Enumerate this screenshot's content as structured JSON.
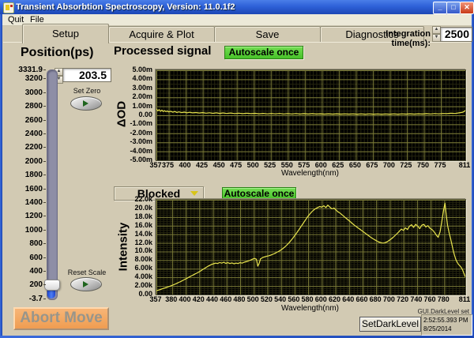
{
  "window": {
    "title": "Transient Absorbtion Spectroscopy, Version: 11.0.1f2"
  },
  "menu": {
    "quit": "Quit",
    "file": "File"
  },
  "tabs": {
    "setup": "Setup",
    "acquire": "Acquire & Plot",
    "save": "Save",
    "diagnostics": "Diagnostics",
    "active": "Setup"
  },
  "integration": {
    "label": "Integration time(ms):",
    "value": "2500"
  },
  "position": {
    "title": "Position(ps)",
    "value": "203.5",
    "min": -3.7,
    "max": 3331.9,
    "handle_value": 203.5,
    "set_zero": "Set Zero",
    "reset_scale": "Reset Scale",
    "abort": "Abort Move",
    "ticks": [
      {
        "v": 3331.9,
        "label": "3331.9"
      },
      {
        "v": 3200,
        "label": "3200"
      },
      {
        "v": 3000,
        "label": "3000"
      },
      {
        "v": 2800,
        "label": "2800"
      },
      {
        "v": 2600,
        "label": "2600"
      },
      {
        "v": 2400,
        "label": "2400"
      },
      {
        "v": 2200,
        "label": "2200"
      },
      {
        "v": 2000,
        "label": "2000"
      },
      {
        "v": 1800,
        "label": "1800"
      },
      {
        "v": 1600,
        "label": "1600"
      },
      {
        "v": 1400,
        "label": "1400"
      },
      {
        "v": 1200,
        "label": "1200"
      },
      {
        "v": 1000,
        "label": "1000"
      },
      {
        "v": 800,
        "label": "800"
      },
      {
        "v": 600,
        "label": "600"
      },
      {
        "v": 400,
        "label": "400"
      },
      {
        "v": 200,
        "label": "200"
      },
      {
        "v": -3.7,
        "label": "-3.7"
      }
    ]
  },
  "dark": {
    "button": "SetDarkLevel",
    "note": "GUI.DarkLevel set",
    "time": "2:52:55.393 PM",
    "date": "8/25/2014"
  },
  "colors": {
    "accent_green": "#55CF35",
    "curve": "#E8E44E",
    "plot_bg": "#000000",
    "grid_major": "#7D7D38",
    "grid_minor": "#25250E",
    "titlebar_blue": "#2E61D8"
  },
  "chart_data": [
    {
      "type": "line",
      "title": "Processed signal",
      "autoscale_label": "Autoscale once",
      "xlabel": "Wavelength(nm)",
      "ylabel": "ΔOD",
      "xlim": [
        357,
        811
      ],
      "ylim": [
        -5,
        5
      ],
      "y_unit": "m (milli-OD)",
      "x_ticks": [
        357,
        375,
        400,
        425,
        450,
        475,
        500,
        525,
        550,
        575,
        600,
        625,
        650,
        675,
        700,
        725,
        750,
        775,
        811
      ],
      "y_ticks": [
        {
          "v": 5,
          "label": "5.00m"
        },
        {
          "v": 4,
          "label": "4.00m"
        },
        {
          "v": 3,
          "label": "3.00m"
        },
        {
          "v": 2,
          "label": "2.00m"
        },
        {
          "v": 1,
          "label": "1.00m"
        },
        {
          "v": 0,
          "label": "0.00"
        },
        {
          "v": -1,
          "label": "-1.00m"
        },
        {
          "v": -2,
          "label": "-2.00m"
        },
        {
          "v": -3,
          "label": "-3.00m"
        },
        {
          "v": -4,
          "label": "-4.00m"
        },
        {
          "v": -5,
          "label": "-5.00m"
        }
      ],
      "points": [
        [
          357,
          0.72
        ],
        [
          359,
          0.5
        ],
        [
          361,
          0.62
        ],
        [
          363,
          0.44
        ],
        [
          365,
          0.58
        ],
        [
          367,
          0.42
        ],
        [
          369,
          0.52
        ],
        [
          371,
          0.4
        ],
        [
          373,
          0.48
        ],
        [
          375,
          0.38
        ],
        [
          378,
          0.45
        ],
        [
          381,
          0.34
        ],
        [
          384,
          0.42
        ],
        [
          387,
          0.32
        ],
        [
          390,
          0.38
        ],
        [
          394,
          0.3
        ],
        [
          398,
          0.35
        ],
        [
          402,
          0.28
        ],
        [
          406,
          0.33
        ],
        [
          410,
          0.27
        ],
        [
          415,
          0.31
        ],
        [
          420,
          0.25
        ],
        [
          425,
          0.3
        ],
        [
          430,
          0.24
        ],
        [
          435,
          0.28
        ],
        [
          440,
          0.22
        ],
        [
          445,
          0.27
        ],
        [
          450,
          0.21
        ],
        [
          455,
          0.26
        ],
        [
          460,
          0.2
        ],
        [
          466,
          0.25
        ],
        [
          472,
          0.19
        ],
        [
          478,
          0.24
        ],
        [
          484,
          0.18
        ],
        [
          490,
          0.23
        ],
        [
          496,
          0.18
        ],
        [
          502,
          0.22
        ],
        [
          508,
          0.17
        ],
        [
          514,
          0.21
        ],
        [
          520,
          0.16
        ],
        [
          526,
          0.2
        ],
        [
          532,
          0.16
        ],
        [
          538,
          0.2
        ],
        [
          544,
          0.15
        ],
        [
          550,
          0.19
        ],
        [
          556,
          0.15
        ],
        [
          562,
          0.19
        ],
        [
          568,
          0.14
        ],
        [
          574,
          0.18
        ],
        [
          580,
          0.14
        ],
        [
          586,
          0.18
        ],
        [
          592,
          0.14
        ],
        [
          598,
          0.17
        ],
        [
          604,
          0.13
        ],
        [
          610,
          0.17
        ],
        [
          616,
          0.13
        ],
        [
          622,
          0.17
        ],
        [
          628,
          0.13
        ],
        [
          634,
          0.16
        ],
        [
          640,
          0.13
        ],
        [
          646,
          0.16
        ],
        [
          652,
          0.12
        ],
        [
          658,
          0.16
        ],
        [
          664,
          0.12
        ],
        [
          670,
          0.16
        ],
        [
          676,
          0.12
        ],
        [
          682,
          0.15
        ],
        [
          688,
          0.12
        ],
        [
          694,
          0.15
        ],
        [
          700,
          0.12
        ],
        [
          706,
          0.16
        ],
        [
          712,
          0.12
        ],
        [
          718,
          0.16
        ],
        [
          724,
          0.13
        ],
        [
          730,
          0.17
        ],
        [
          736,
          0.13
        ],
        [
          742,
          0.17
        ],
        [
          748,
          0.14
        ],
        [
          754,
          0.18
        ],
        [
          760,
          0.15
        ],
        [
          766,
          0.19
        ],
        [
          772,
          0.16
        ],
        [
          778,
          0.2
        ],
        [
          784,
          0.18
        ],
        [
          790,
          0.23
        ],
        [
          796,
          0.2
        ],
        [
          802,
          0.27
        ],
        [
          806,
          0.32
        ],
        [
          809,
          0.4
        ],
        [
          811,
          0.55
        ]
      ]
    },
    {
      "type": "line",
      "title": "Blocked",
      "title_is_dropdown": true,
      "autoscale_label": "Autoscale once",
      "xlabel": "Wavelength(nm)",
      "ylabel": "Intensity",
      "xlim": [
        357,
        811
      ],
      "ylim": [
        0,
        22
      ],
      "y_unit": "k (kilo-counts)",
      "x_ticks": [
        357,
        380,
        400,
        420,
        440,
        460,
        480,
        500,
        520,
        540,
        560,
        580,
        600,
        620,
        640,
        660,
        680,
        700,
        720,
        740,
        760,
        780,
        811
      ],
      "y_ticks": [
        {
          "v": 22,
          "label": "22.0k"
        },
        {
          "v": 20,
          "label": "20.0k"
        },
        {
          "v": 18,
          "label": "18.0k"
        },
        {
          "v": 16,
          "label": "16.0k"
        },
        {
          "v": 14,
          "label": "14.0k"
        },
        {
          "v": 12,
          "label": "12.0k"
        },
        {
          "v": 10,
          "label": "10.0k"
        },
        {
          "v": 8,
          "label": "8.00k"
        },
        {
          "v": 6,
          "label": "6.00k"
        },
        {
          "v": 4,
          "label": "4.00k"
        },
        {
          "v": 2,
          "label": "2.00k"
        },
        {
          "v": 0,
          "label": "0.00"
        }
      ],
      "points": [
        [
          357,
          0.9
        ],
        [
          360,
          1.05
        ],
        [
          363,
          1.2
        ],
        [
          366,
          1.35
        ],
        [
          369,
          1.5
        ],
        [
          372,
          1.65
        ],
        [
          375,
          1.85
        ],
        [
          378,
          2.0
        ],
        [
          381,
          2.2
        ],
        [
          384,
          2.4
        ],
        [
          387,
          2.6
        ],
        [
          390,
          2.85
        ],
        [
          393,
          3.05
        ],
        [
          396,
          3.3
        ],
        [
          399,
          3.55
        ],
        [
          402,
          3.8
        ],
        [
          405,
          4.05
        ],
        [
          408,
          4.3
        ],
        [
          411,
          4.55
        ],
        [
          414,
          4.8
        ],
        [
          417,
          5.05
        ],
        [
          420,
          5.3
        ],
        [
          423,
          5.6
        ],
        [
          426,
          5.9
        ],
        [
          429,
          6.2
        ],
        [
          432,
          6.5
        ],
        [
          435,
          6.75
        ],
        [
          438,
          7.0
        ],
        [
          441,
          7.15
        ],
        [
          444,
          7.3
        ],
        [
          447,
          7.2
        ],
        [
          450,
          7.45
        ],
        [
          453,
          7.3
        ],
        [
          456,
          7.5
        ],
        [
          459,
          7.25
        ],
        [
          462,
          7.4
        ],
        [
          465,
          7.2
        ],
        [
          468,
          7.35
        ],
        [
          471,
          7.15
        ],
        [
          474,
          7.3
        ],
        [
          477,
          7.2
        ],
        [
          480,
          7.4
        ],
        [
          483,
          7.3
        ],
        [
          486,
          7.5
        ],
        [
          489,
          7.65
        ],
        [
          492,
          7.8
        ],
        [
          495,
          8.0
        ],
        [
          498,
          8.2
        ],
        [
          501,
          8.4
        ],
        [
          504,
          8.2
        ],
        [
          506,
          6.6
        ],
        [
          508,
          7.2
        ],
        [
          510,
          8.3
        ],
        [
          513,
          8.6
        ],
        [
          516,
          8.75
        ],
        [
          519,
          8.9
        ],
        [
          522,
          9.0
        ],
        [
          525,
          9.15
        ],
        [
          528,
          9.35
        ],
        [
          531,
          9.55
        ],
        [
          534,
          9.8
        ],
        [
          537,
          10.05
        ],
        [
          540,
          10.35
        ],
        [
          543,
          10.7
        ],
        [
          546,
          11.1
        ],
        [
          549,
          11.55
        ],
        [
          552,
          12.05
        ],
        [
          555,
          12.6
        ],
        [
          558,
          13.2
        ],
        [
          561,
          13.85
        ],
        [
          564,
          14.5
        ],
        [
          567,
          15.2
        ],
        [
          570,
          15.9
        ],
        [
          573,
          16.6
        ],
        [
          576,
          17.3
        ],
        [
          579,
          18.0
        ],
        [
          582,
          18.6
        ],
        [
          585,
          19.15
        ],
        [
          588,
          19.6
        ],
        [
          591,
          19.95
        ],
        [
          594,
          20.2
        ],
        [
          597,
          20.45
        ],
        [
          600,
          20.3
        ],
        [
          603,
          20.6
        ],
        [
          606,
          20.2
        ],
        [
          609,
          20.75
        ],
        [
          612,
          20.3
        ],
        [
          615,
          19.9
        ],
        [
          618,
          20.1
        ],
        [
          621,
          19.6
        ],
        [
          624,
          19.2
        ],
        [
          627,
          18.9
        ],
        [
          630,
          18.5
        ],
        [
          633,
          18.1
        ],
        [
          636,
          17.7
        ],
        [
          639,
          17.3
        ],
        [
          642,
          16.9
        ],
        [
          645,
          16.5
        ],
        [
          648,
          16.1
        ],
        [
          651,
          15.75
        ],
        [
          654,
          15.4
        ],
        [
          657,
          15.05
        ],
        [
          660,
          14.7
        ],
        [
          663,
          14.35
        ],
        [
          666,
          14.0
        ],
        [
          669,
          13.65
        ],
        [
          672,
          13.3
        ],
        [
          675,
          13.0
        ],
        [
          678,
          12.7
        ],
        [
          681,
          12.45
        ],
        [
          684,
          12.2
        ],
        [
          687,
          12.05
        ],
        [
          690,
          11.95
        ],
        [
          693,
          12.05
        ],
        [
          696,
          12.25
        ],
        [
          699,
          12.55
        ],
        [
          702,
          12.9
        ],
        [
          705,
          13.3
        ],
        [
          708,
          13.75
        ],
        [
          711,
          14.2
        ],
        [
          714,
          14.7
        ],
        [
          717,
          15.2
        ],
        [
          720,
          14.9
        ],
        [
          723,
          15.5
        ],
        [
          726,
          15.1
        ],
        [
          729,
          15.9
        ],
        [
          732,
          16.2
        ],
        [
          735,
          15.6
        ],
        [
          738,
          16.3
        ],
        [
          741,
          15.9
        ],
        [
          744,
          15.3
        ],
        [
          747,
          16.1
        ],
        [
          750,
          16.3
        ],
        [
          753,
          15.7
        ],
        [
          756,
          16.0
        ],
        [
          759,
          15.4
        ],
        [
          762,
          15.1
        ],
        [
          765,
          14.6
        ],
        [
          768,
          13.9
        ],
        [
          771,
          13.3
        ],
        [
          774,
          14.6
        ],
        [
          777,
          17.5
        ],
        [
          779,
          19.5
        ],
        [
          781,
          21.2
        ],
        [
          783,
          18.5
        ],
        [
          785,
          16.0
        ],
        [
          787,
          14.5
        ],
        [
          789,
          13.2
        ],
        [
          791,
          11.8
        ],
        [
          793,
          10.4
        ],
        [
          795,
          9.2
        ],
        [
          797,
          8.2
        ],
        [
          799,
          7.5
        ],
        [
          801,
          7.0
        ],
        [
          803,
          6.7
        ],
        [
          805,
          6.3
        ],
        [
          807,
          5.7
        ],
        [
          809,
          4.9
        ],
        [
          811,
          4.1
        ]
      ]
    }
  ]
}
